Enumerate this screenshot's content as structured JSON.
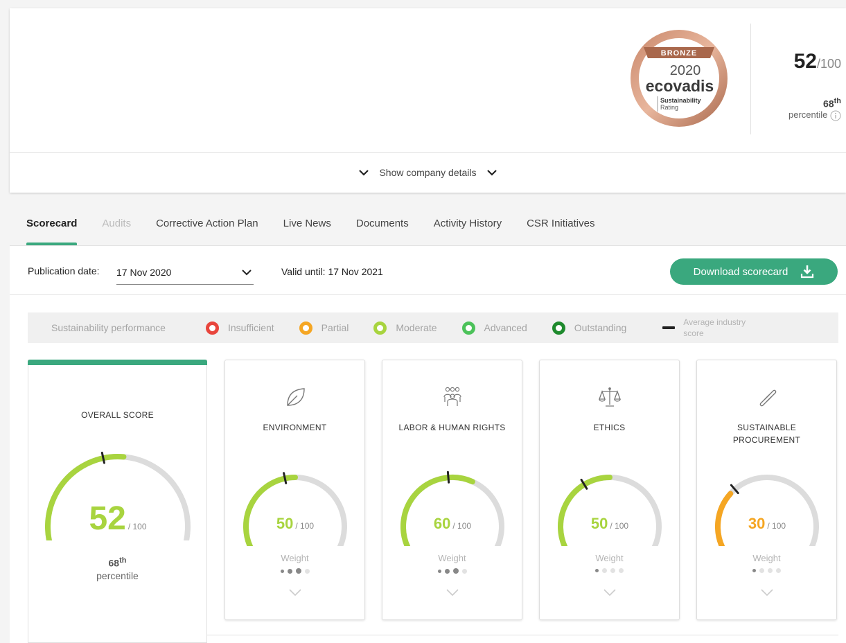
{
  "header": {
    "medal": {
      "level": "BRONZE",
      "year": "2020",
      "brand": "ecovadis",
      "tagline_1": "Sustainability",
      "tagline_2": "Rating"
    },
    "score": "52",
    "score_max": "/100",
    "percentile_num": "68",
    "percentile_suffix": "th",
    "percentile_label": "percentile",
    "show_details": "Show company details"
  },
  "tabs": [
    {
      "label": "Scorecard"
    },
    {
      "label": "Audits"
    },
    {
      "label": "Corrective Action Plan"
    },
    {
      "label": "Live News"
    },
    {
      "label": "Documents"
    },
    {
      "label": "Activity History"
    },
    {
      "label": "CSR Initiatives"
    }
  ],
  "scorecard": {
    "publication_label": "Publication date:",
    "publication_value": "17 Nov 2020",
    "valid_until": "Valid until: 17 Nov 2021",
    "download_label": "Download scorecard"
  },
  "legend": {
    "title": "Sustainability performance",
    "items": [
      {
        "label": "Insufficient",
        "color": "#e8453c"
      },
      {
        "label": "Partial",
        "color": "#f5a623"
      },
      {
        "label": "Moderate",
        "color": "#a8d43f"
      },
      {
        "label": "Advanced",
        "color": "#4cc25a"
      },
      {
        "label": "Outstanding",
        "color": "#1e8a2d"
      }
    ],
    "avg_label": "Average industry score"
  },
  "overall": {
    "title": "OVERALL SCORE",
    "score": 52,
    "score_text": "52",
    "max_text": "/ 100",
    "color": "#a8d43f",
    "industry_avg": 45,
    "percentile_num": "68",
    "percentile_suffix": "th",
    "percentile_label": "percentile"
  },
  "themes": [
    {
      "title": "ENVIRONMENT",
      "icon": "leaf-icon",
      "score": 50,
      "score_text": "50",
      "max_text": "/ 100",
      "color": "#a8d43f",
      "industry_avg": 45,
      "weight_label": "Weight",
      "weight": 3
    },
    {
      "title": "LABOR & HUMAN RIGHTS",
      "icon": "people-icon",
      "score": 60,
      "score_text": "60",
      "max_text": "/ 100",
      "color": "#a8d43f",
      "industry_avg": 48,
      "weight_label": "Weight",
      "weight": 3
    },
    {
      "title": "ETHICS",
      "icon": "scales-icon",
      "score": 50,
      "score_text": "50",
      "max_text": "/ 100",
      "color": "#a8d43f",
      "industry_avg": 37,
      "weight_label": "Weight",
      "weight": 1
    },
    {
      "title": "SUSTAINABLE PROCUREMENT",
      "icon": "link-icon",
      "score": 30,
      "score_text": "30",
      "max_text": "/ 100",
      "color": "#f5a623",
      "industry_avg": 33,
      "weight_label": "Weight",
      "weight": 1
    }
  ]
}
